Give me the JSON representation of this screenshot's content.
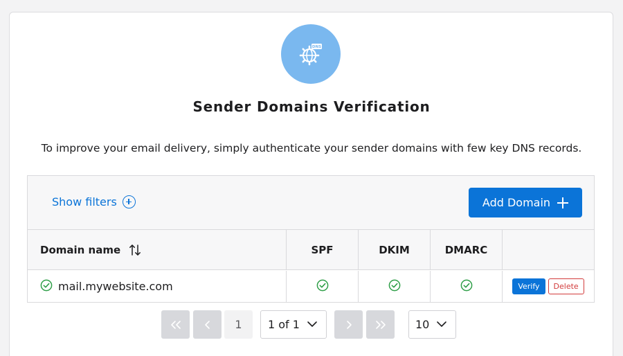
{
  "title": "Sender Domains Verification",
  "description": "To improve your email delivery, simply authenticate your sender domains with few key DNS records.",
  "hero_icon": "dns-globe-gear-icon",
  "toolbar": {
    "show_filters_label": "Show filters",
    "add_domain_label": "Add Domain"
  },
  "table": {
    "columns": [
      "Domain name",
      "SPF",
      "DKIM",
      "DMARC",
      ""
    ],
    "rows": [
      {
        "domain": "mail.mywebsite.com",
        "verified": true,
        "spf": "ok",
        "dkim": "ok",
        "dmarc": "ok",
        "verify_label": "Verify",
        "delete_label": "Delete"
      }
    ]
  },
  "pagination": {
    "current_page": "1",
    "page_select": "1 of 1",
    "page_size": "10"
  },
  "colors": {
    "accent": "#0b74d8",
    "hero_circle": "#7ab8ef",
    "success": "#2e9e47",
    "danger": "#d23b3b"
  }
}
